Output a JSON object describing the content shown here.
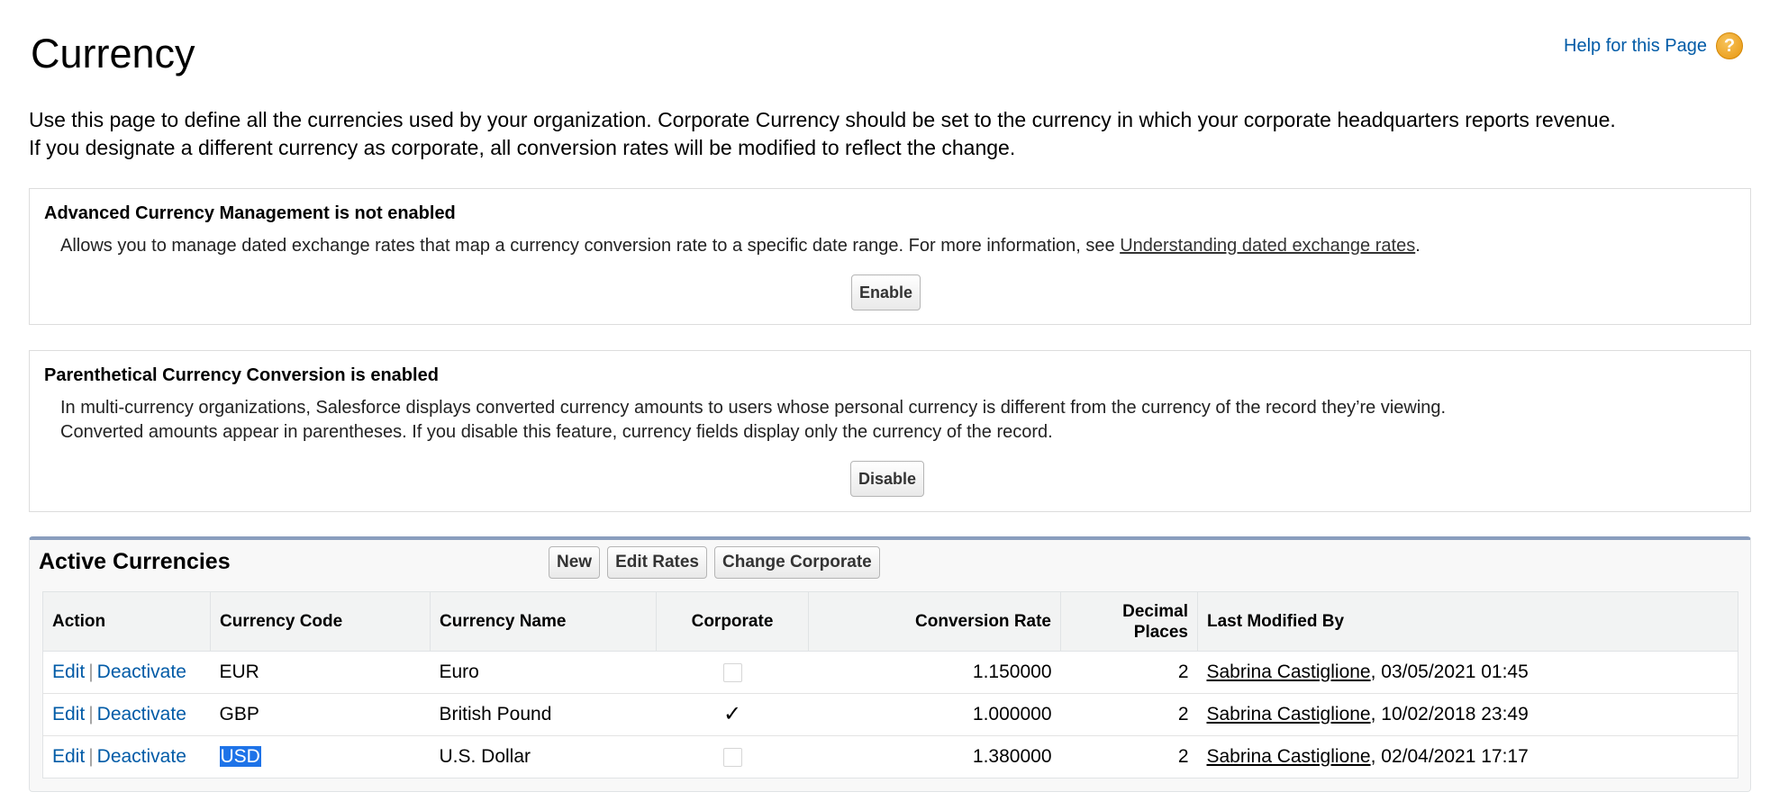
{
  "page": {
    "title": "Currency",
    "help_link": "Help for this Page",
    "help_icon": "question-mark-icon",
    "intro_line1": "Use this page to define all the currencies used by your organization. Corporate Currency should be set to the currency in which your corporate headquarters reports revenue.",
    "intro_line2": "If you designate a different currency as corporate, all conversion rates will be modified to reflect the change."
  },
  "advanced_panel": {
    "heading": "Advanced Currency Management is not enabled",
    "description": "Allows you to manage dated exchange rates that map a currency conversion rate to a specific date range. For more information, see ",
    "link": "Understanding dated exchange rates",
    "description_end": ".",
    "button": "Enable"
  },
  "parenthetical_panel": {
    "heading": "Parenthetical Currency Conversion is enabled",
    "description_line1": "In multi-currency organizations, Salesforce displays converted currency amounts to users whose personal currency is different from the currency of the record they’re viewing.",
    "description_line2": "Converted amounts appear in parentheses. If you disable this feature, currency fields display only the currency of the record.",
    "button": "Disable"
  },
  "active_currencies": {
    "heading": "Active Currencies",
    "buttons": {
      "new": "New",
      "edit_rates": "Edit Rates",
      "change_corporate": "Change Corporate"
    },
    "columns": {
      "action": "Action",
      "code": "Currency Code",
      "name": "Currency Name",
      "corporate": "Corporate",
      "rate": "Conversion Rate",
      "decimal_line1": "Decimal",
      "decimal_line2": "Places",
      "modified": "Last Modified By"
    },
    "rows": [
      {
        "edit": "Edit",
        "sep": "|",
        "deactivate": "Deactivate",
        "code": "EUR",
        "name": "Euro",
        "corporate": false,
        "rate": "1.150000",
        "decimals": "2",
        "modified_by": "Sabrina Castiglione",
        "modified_at": ", 03/05/2021 01:45"
      },
      {
        "edit": "Edit",
        "sep": "|",
        "deactivate": "Deactivate",
        "code": "GBP",
        "name": "British Pound",
        "corporate": true,
        "corporate_mark": "✓",
        "rate": "1.000000",
        "decimals": "2",
        "modified_by": "Sabrina Castiglione",
        "modified_at": ", 10/02/2018 23:49"
      },
      {
        "edit": "Edit",
        "sep": "|",
        "deactivate": "Deactivate",
        "code": "USD",
        "code_selected": true,
        "name": "U.S. Dollar",
        "corporate": false,
        "rate": "1.380000",
        "decimals": "2",
        "modified_by": "Sabrina Castiglione",
        "modified_at": ", 02/04/2021 17:17"
      }
    ]
  },
  "colors": {
    "link": "#015ba7",
    "selection": "#1e73e8",
    "panel_accent": "#8a9ebe"
  }
}
